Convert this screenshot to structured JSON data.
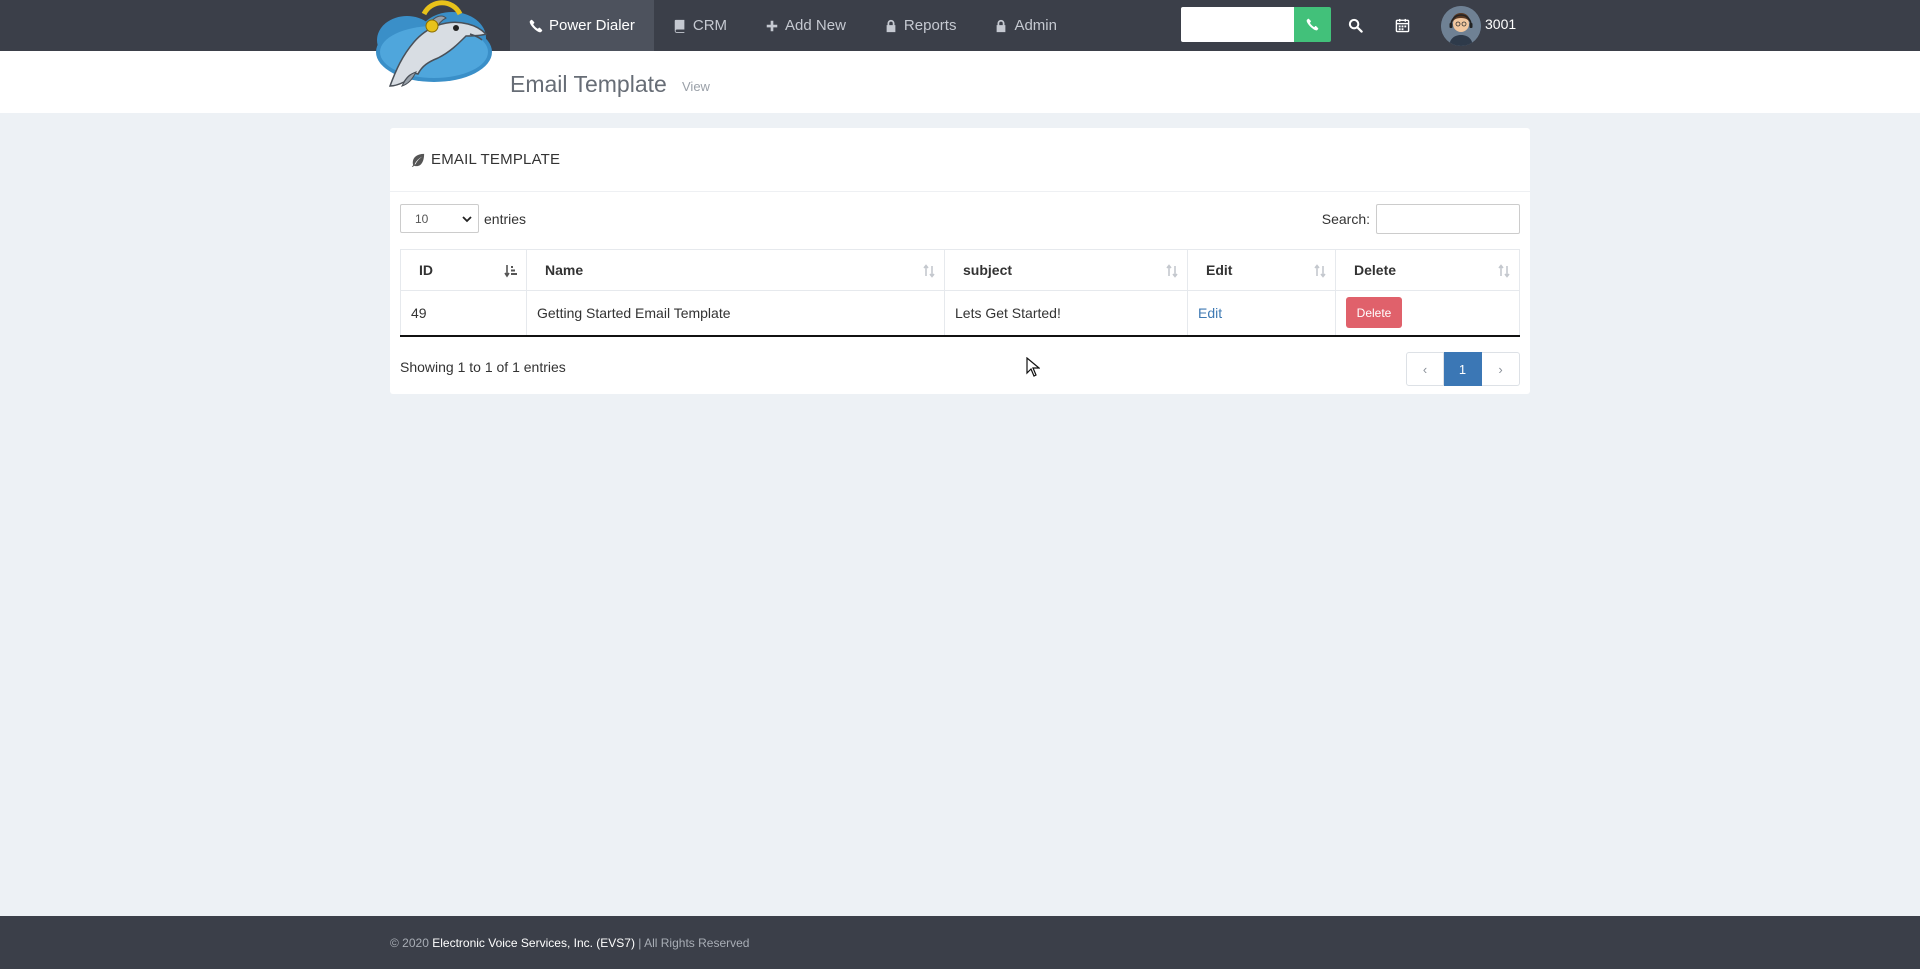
{
  "nav": {
    "items": [
      {
        "label": "Power Dialer",
        "icon": "phone-handset-icon",
        "active": true
      },
      {
        "label": "CRM",
        "icon": "book-icon",
        "active": false
      },
      {
        "label": "Add New",
        "icon": "plus-icon",
        "active": false
      },
      {
        "label": "Reports",
        "icon": "lock-icon",
        "active": false
      },
      {
        "label": "Admin",
        "icon": "lock-icon",
        "active": false
      }
    ],
    "dial_value": "",
    "user_extension": "3001"
  },
  "header": {
    "title": "Email Template",
    "subtitle": "View"
  },
  "panel": {
    "title": "EMAIL TEMPLATE",
    "length_value": "10",
    "length_label": "entries",
    "search_label": "Search:",
    "search_value": "",
    "columns": [
      "ID",
      "Name",
      "subject",
      "Edit",
      "Delete"
    ],
    "rows": [
      {
        "id": "49",
        "name": "Getting Started Email Template",
        "subject": "Lets Get Started!",
        "edit": "Edit",
        "delete": "Delete"
      }
    ],
    "info": "Showing 1 to 1 of 1 entries",
    "pagination": {
      "prev": "‹",
      "current": "1",
      "next": "›"
    }
  },
  "footer": {
    "prefix": "© 2020 ",
    "company": "Electronic Voice Services, Inc. (EVS7)",
    "suffix": " | All Rights Reserved"
  },
  "colors": {
    "topbar": "#3b3f49",
    "call_button": "#42c17a",
    "delete_button": "#e0616b",
    "pager_active": "#3b77b5",
    "link": "#3f7ab3"
  }
}
